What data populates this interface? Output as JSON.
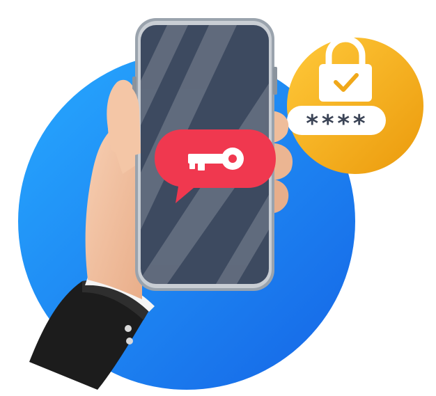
{
  "pin_field": {
    "masked_value": "****"
  },
  "colors": {
    "background_circle": "#1e90f5",
    "lock_badge": "#f3b11f",
    "phone_screen": "#3d4a60",
    "phone_frame": "#9aa3ad",
    "message_bubble": "#f0384f",
    "skin": "#f2c3a3",
    "sleeve": "#1f1f1f"
  },
  "icons": {
    "badge": "padlock-with-checkmark",
    "bubble": "key-icon"
  }
}
